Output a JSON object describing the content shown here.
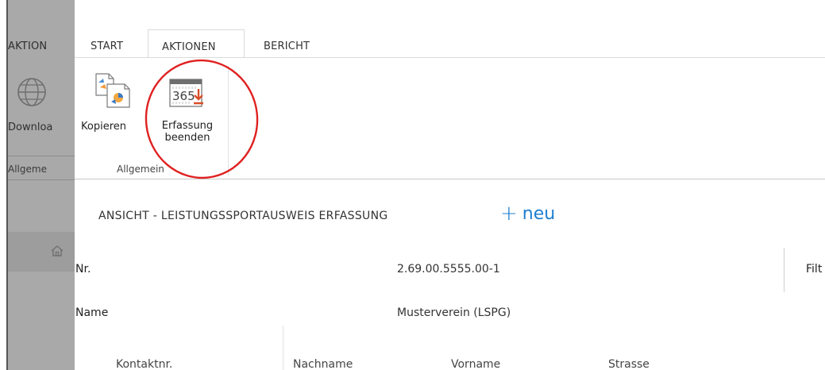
{
  "background_app": {
    "tab_partial": "AKTION",
    "download_label": "Downloa",
    "group_label": "Allgeme"
  },
  "ribbon": {
    "tabs": [
      {
        "label": "START"
      },
      {
        "label": "AKTIONEN",
        "active": true
      },
      {
        "label": "BERICHT"
      }
    ],
    "buttons": {
      "kopieren": {
        "label": "Kopieren",
        "icon": "copy-documents-icon"
      },
      "erfassung": {
        "label_line1": "Erfassung",
        "label_line2": "beenden",
        "icon": "calendar-365-download-icon",
        "icon_text": "365"
      }
    },
    "group_label": "Allgemein"
  },
  "page": {
    "title": "ANSICHT - LEISTUNGSSPORTAUSWEIS ERFASSUNG",
    "new_label": "neu",
    "new_icon": "plus-icon",
    "fields": [
      {
        "label": "Nr.",
        "value": "2.69.00.5555.00-1"
      },
      {
        "label": "Name",
        "value": "Musterverein (LSPG)"
      }
    ],
    "filter_label": "Filt",
    "columns": [
      "Kontaktnr.",
      "Nachname",
      "Vorname",
      "Strasse"
    ]
  },
  "colors": {
    "accent": "#1e7fd0",
    "annotation": "#e02020",
    "overlay": "#a9a9a9"
  }
}
